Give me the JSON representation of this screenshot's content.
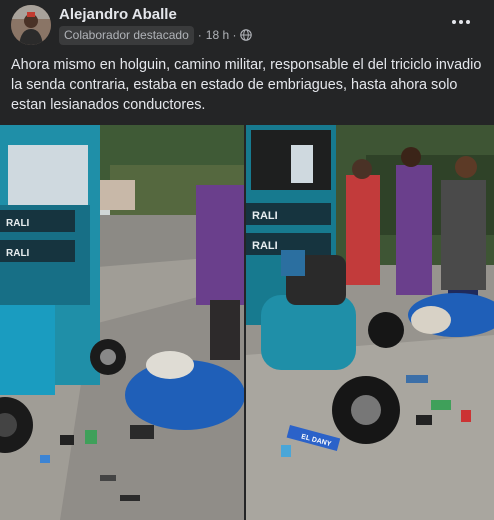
{
  "post": {
    "author": "Alejandro Aballe",
    "badge": "Colaborador destacado",
    "separator": "·",
    "time": "18 h ·",
    "privacy_icon": "globe-icon",
    "more_icon": "more-options-icon",
    "text": "Ahora mismo en holguin, camino militar, responsable el del triciclo invadio la senda contraria, estaba en estado de embriagues, hasta ahora solo estan lesianados conductores."
  },
  "photos": {
    "left": {
      "sign_text_1": "RALI",
      "sign_text_2": "RALI"
    },
    "right": {
      "sign_text_1": "RALI",
      "sign_text_2": "RALI",
      "debris_text": "EL DANY"
    }
  },
  "colors": {
    "background": "#242526",
    "text_primary": "#e4e6eb",
    "text_secondary": "#b0b3b8",
    "badge_bg": "#3a3b3c",
    "vehicle_teal": "#1f8fa8",
    "moto_blue": "#1f5fb8"
  }
}
